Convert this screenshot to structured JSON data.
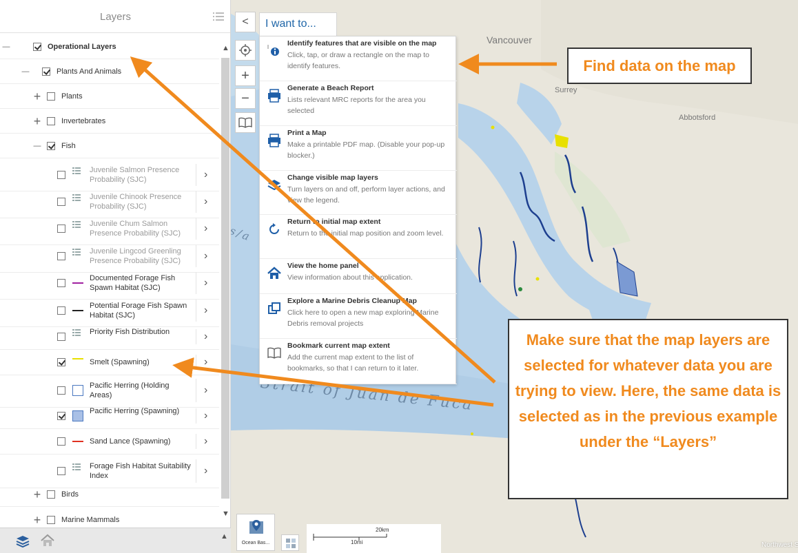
{
  "panel": {
    "title": "Layers",
    "tree": [
      {
        "label": "Operational Layers",
        "state": "expanded",
        "checked": true,
        "bold": true,
        "level": 0
      },
      {
        "label": "Plants And Animals",
        "state": "expanded",
        "checked": true,
        "level": 1
      },
      {
        "label": "Plants",
        "state": "collapsed",
        "checked": false,
        "level": 2
      },
      {
        "label": "Invertebrates",
        "state": "collapsed",
        "checked": false,
        "level": 2
      },
      {
        "label": "Fish",
        "state": "expanded",
        "checked": true,
        "level": 2
      },
      {
        "label": "Juvenile Salmon Presence Probability (SJC)",
        "checked": false,
        "gray": true,
        "symbol": "legend-icon",
        "level": 3
      },
      {
        "label": "Juvenile Chinook Presence Probability (SJC)",
        "checked": false,
        "gray": true,
        "symbol": "legend-icon",
        "level": 3
      },
      {
        "label": "Juvenile Chum Salmon Presence Probability (SJC)",
        "checked": false,
        "gray": true,
        "symbol": "legend-icon",
        "level": 3
      },
      {
        "label": "Juvenile Lingcod Greenling Presence Probability (SJC)",
        "checked": false,
        "gray": true,
        "symbol": "legend-icon",
        "level": 3
      },
      {
        "label": "Documented Forage Fish Spawn Habitat (SJC)",
        "checked": false,
        "symbol": "line",
        "color": "#a020a0",
        "level": 3
      },
      {
        "label": "Potential Forage Fish Spawn Habitat (SJC)",
        "checked": false,
        "symbol": "line",
        "color": "#222222",
        "level": 3
      },
      {
        "label": "Priority Fish Distribution",
        "checked": false,
        "symbol": "legend-icon",
        "level": 3
      },
      {
        "label": "Smelt (Spawning)",
        "checked": true,
        "symbol": "line",
        "color": "#e8e000",
        "level": 3
      },
      {
        "label": "Pacific Herring (Holding Areas)",
        "checked": false,
        "symbol": "box",
        "color": "#4a78c0",
        "level": 3
      },
      {
        "label": "Pacific Herring (Spawning)",
        "checked": true,
        "symbol": "box-fill",
        "color": "#4a78c0",
        "level": 3
      },
      {
        "label": "Sand Lance (Spawning)",
        "checked": false,
        "symbol": "line",
        "color": "#e03020",
        "level": 3
      },
      {
        "label": "Forage Fish Habitat Suitability Index",
        "checked": false,
        "symbol": "legend-icon",
        "level": 3
      },
      {
        "label": "Birds",
        "state": "collapsed",
        "checked": false,
        "level": 2
      },
      {
        "label": "Marine Mammals",
        "state": "collapsed",
        "checked": false,
        "level": 2
      }
    ]
  },
  "toolbar": {
    "collapse": "<",
    "zoom_in": "+",
    "zoom_out": "−"
  },
  "iwant": {
    "label": "I want to...",
    "items": [
      {
        "title": "Identify features that are visible on the map",
        "desc": "Click, tap, or draw a rectangle on the map to identify features.",
        "icon": "identify-icon"
      },
      {
        "title": "Generate a Beach Report",
        "desc": "Lists relevant MRC reports for the area you selected",
        "icon": "printer-icon"
      },
      {
        "title": "Print a Map",
        "desc": "Make a printable PDF map. (Disable your pop-up blocker.)",
        "icon": "printer-icon"
      },
      {
        "title": "Change visible map layers",
        "desc": "Turn layers on and off, perform layer actions, and view the legend.",
        "icon": "layers-icon"
      },
      {
        "title": "Return to initial map extent",
        "desc": "Return to the initial map position and zoom level.",
        "icon": "refresh-icon"
      },
      {
        "title": "View the home panel",
        "desc": "View information about this application.",
        "icon": "home-icon"
      },
      {
        "title": "Explore a Marine Debris Cleanup Map",
        "desc": "Click here to open a new map exploring Marine Debris removal projects",
        "icon": "external-link-icon"
      },
      {
        "title": "Bookmark current map extent",
        "desc": "Add the current map extent to the list of bookmarks, so that I can return to it later.",
        "icon": "book-icon"
      }
    ]
  },
  "map": {
    "places": [
      "Vancouver",
      "Surrey",
      "Abbotsford"
    ],
    "strait": "Strait of Juan de Fuca",
    "strait_fragment": "s/a",
    "basemap_label": "Ocean Bas...",
    "scale_km": "20km",
    "scale_mi": "10mi",
    "attribution": "Northwest Straits and Marine Resource Committees | Northwest Straits..."
  },
  "annotations": {
    "callout1": "Find data on the map",
    "callout2": "Make sure that the map layers are selected for whatever data you are trying to view. Here, the same data is selected as in the previous example under the “Layers”",
    "accent": "#f08a1e"
  }
}
